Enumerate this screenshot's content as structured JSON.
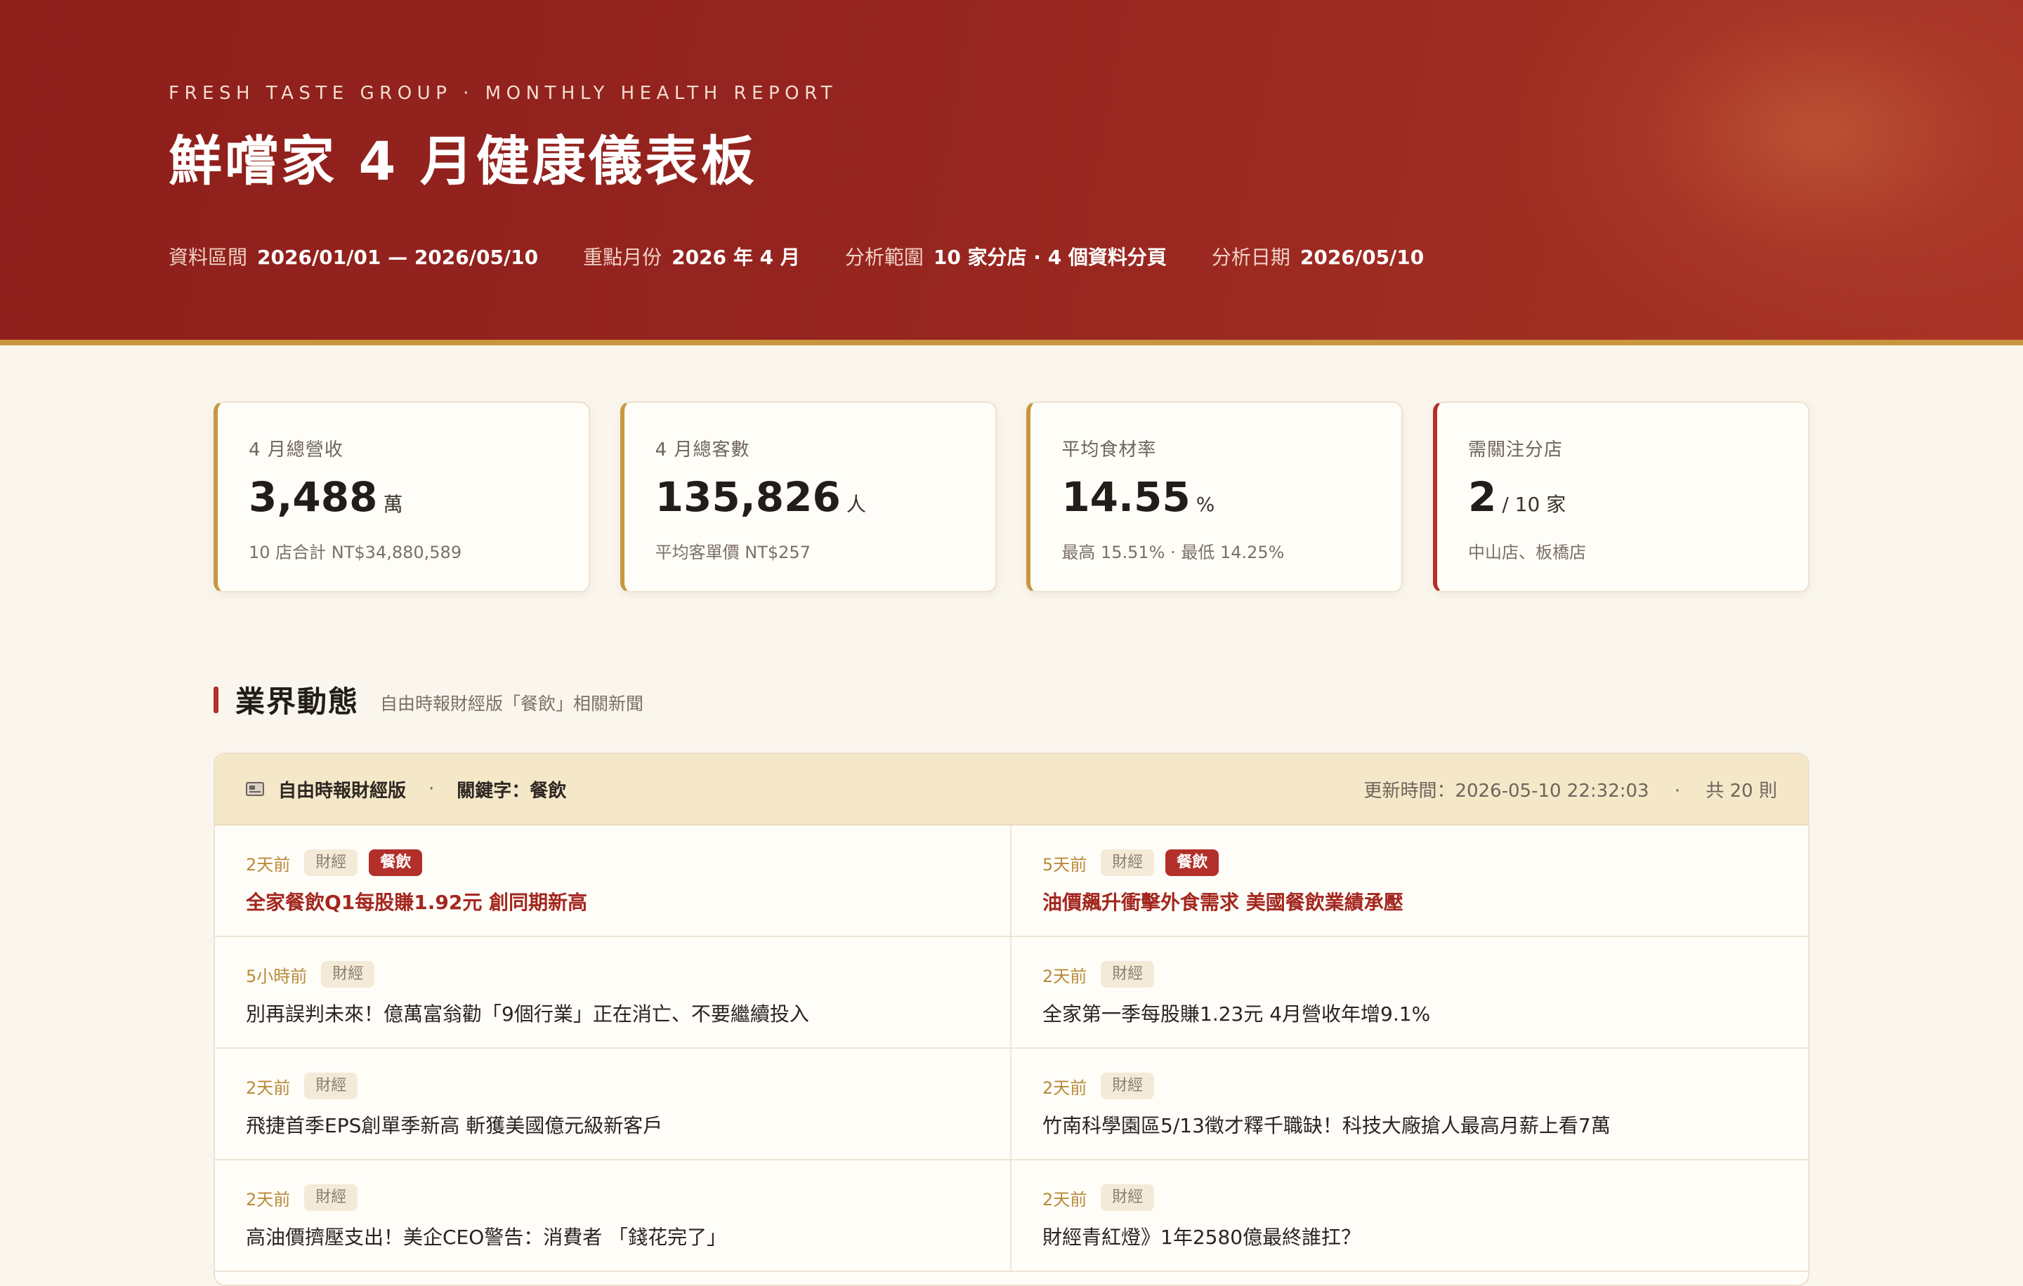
{
  "hero": {
    "eyebrow": "FRESH TASTE GROUP · MONTHLY HEALTH REPORT",
    "title": "鮮嚐家 4 月健康儀表板",
    "meta": [
      {
        "label": "資料區間",
        "value": "2026/01/01 — 2026/05/10"
      },
      {
        "label": "重點月份",
        "value": "2026 年 4 月"
      },
      {
        "label": "分析範圍",
        "value": "10 家分店 · 4 個資料分頁"
      },
      {
        "label": "分析日期",
        "value": "2026/05/10"
      }
    ]
  },
  "kpis": [
    {
      "label": "4 月總營收",
      "value": "3,488",
      "unit": "萬",
      "sub": "10 店合計 NT$34,880,589",
      "alert": false
    },
    {
      "label": "4 月總客數",
      "value": "135,826",
      "unit": "人",
      "sub": "平均客單價 NT$257",
      "alert": false
    },
    {
      "label": "平均食材率",
      "value": "14.55",
      "unit": "%",
      "sub": "最高 15.51% · 最低 14.25%",
      "alert": false
    },
    {
      "label": "需關注分店",
      "value": "2",
      "unit": "/ 10 家",
      "sub": "中山店、板橋店",
      "alert": true
    }
  ],
  "section": {
    "title": "業界動態",
    "subtitle": "自由時報財經版「餐飲」相關新聞"
  },
  "news": {
    "source": "自由時報財經版",
    "keyword": "關鍵字：餐飲",
    "updated": "更新時間：2026-05-10 22:32:03",
    "count": "共 20 則",
    "colors": {
      "accent": "#b3302a",
      "gold": "#c9963f"
    },
    "items": [
      {
        "time": "2天前",
        "category": "財經",
        "hot_tag": "餐飲",
        "title": "全家餐飲Q1每股賺1.92元 創同期新高"
      },
      {
        "time": "5天前",
        "category": "財經",
        "hot_tag": "餐飲",
        "title": "油價飆升衝擊外食需求 美國餐飲業績承壓"
      },
      {
        "time": "5小時前",
        "category": "財經",
        "hot_tag": null,
        "title": "別再誤判未來！億萬富翁勸「9個行業」正在消亡、不要繼續投入"
      },
      {
        "time": "2天前",
        "category": "財經",
        "hot_tag": null,
        "title": "全家第一季每股賺1.23元 4月營收年增9.1%"
      },
      {
        "time": "2天前",
        "category": "財經",
        "hot_tag": null,
        "title": "飛捷首季EPS創單季新高 斬獲美國億元級新客戶"
      },
      {
        "time": "2天前",
        "category": "財經",
        "hot_tag": null,
        "title": "竹南科學園區5/13徵才釋千職缺！科技大廠搶人最高月薪上看7萬"
      },
      {
        "time": "2天前",
        "category": "財經",
        "hot_tag": null,
        "title": "高油價擠壓支出！美企CEO警告：消費者 「錢花完了」"
      },
      {
        "time": "2天前",
        "category": "財經",
        "hot_tag": null,
        "title": "財經青紅燈》1年2580億最終誰扛？"
      }
    ]
  }
}
